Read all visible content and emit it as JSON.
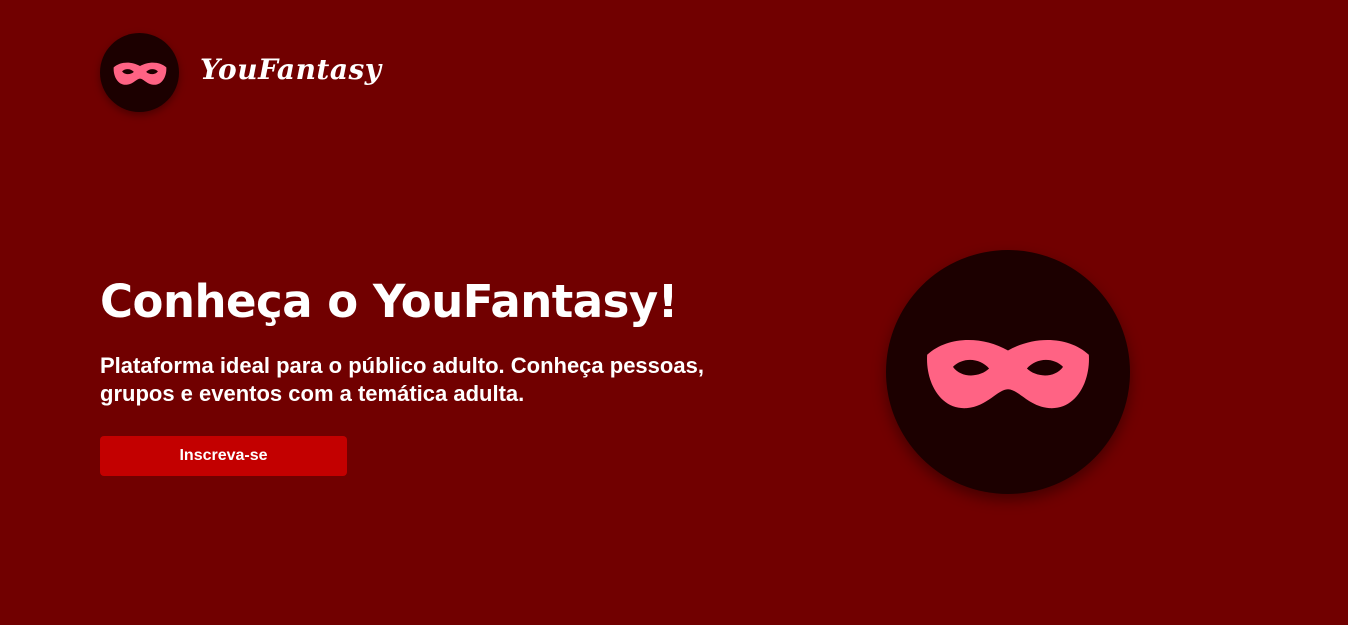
{
  "header": {
    "brand_name": "YouFantasy",
    "logo_icon": "mask-icon"
  },
  "hero": {
    "title": "Conheça o YouFantasy!",
    "subtitle": "Plataforma ideal para o público adulto. Conheça pessoas, grupos e eventos com a temática adulta.",
    "cta_label": "Inscreva-se",
    "illustration_icon": "mask-icon"
  },
  "colors": {
    "background": "#710000",
    "badge": "#1c0000",
    "mask": "#ff6384",
    "button": "#c30000",
    "text": "#ffffff"
  }
}
